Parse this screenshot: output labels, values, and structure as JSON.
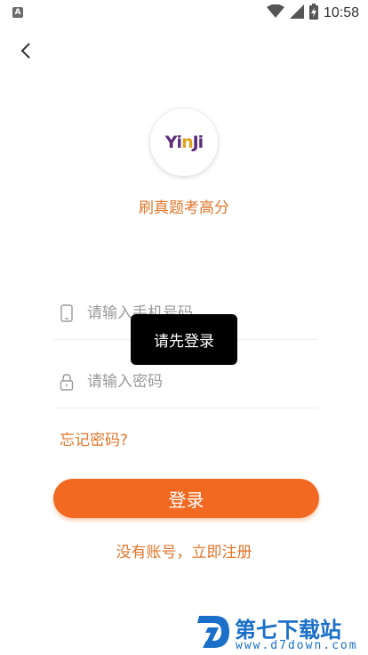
{
  "status_bar": {
    "app_icon_letter": "A",
    "time": "10:58",
    "icons": [
      "wifi-icon",
      "signal-icon",
      "battery-charging-icon"
    ]
  },
  "header": {
    "back_icon": "chevron-left-icon"
  },
  "logo": {
    "text_part1": "Yi",
    "text_part2": "n",
    "text_part3": "Ji"
  },
  "slogan": "刷真题考高分",
  "form": {
    "phone_placeholder": "请输入手机号码",
    "password_placeholder": "请输入密码",
    "phone_icon": "phone-icon",
    "lock_icon": "lock-icon"
  },
  "forgot_password": "忘记密码?",
  "login_button": "登录",
  "register_link": "没有账号，立即注册",
  "toast": "请先登录",
  "watermark": {
    "title": "第七下载站",
    "url": "www.d7down.com"
  },
  "colors": {
    "accent": "#f26a22",
    "accent_text": "#e0762b",
    "watermark_blue": "#1a6fc8"
  }
}
